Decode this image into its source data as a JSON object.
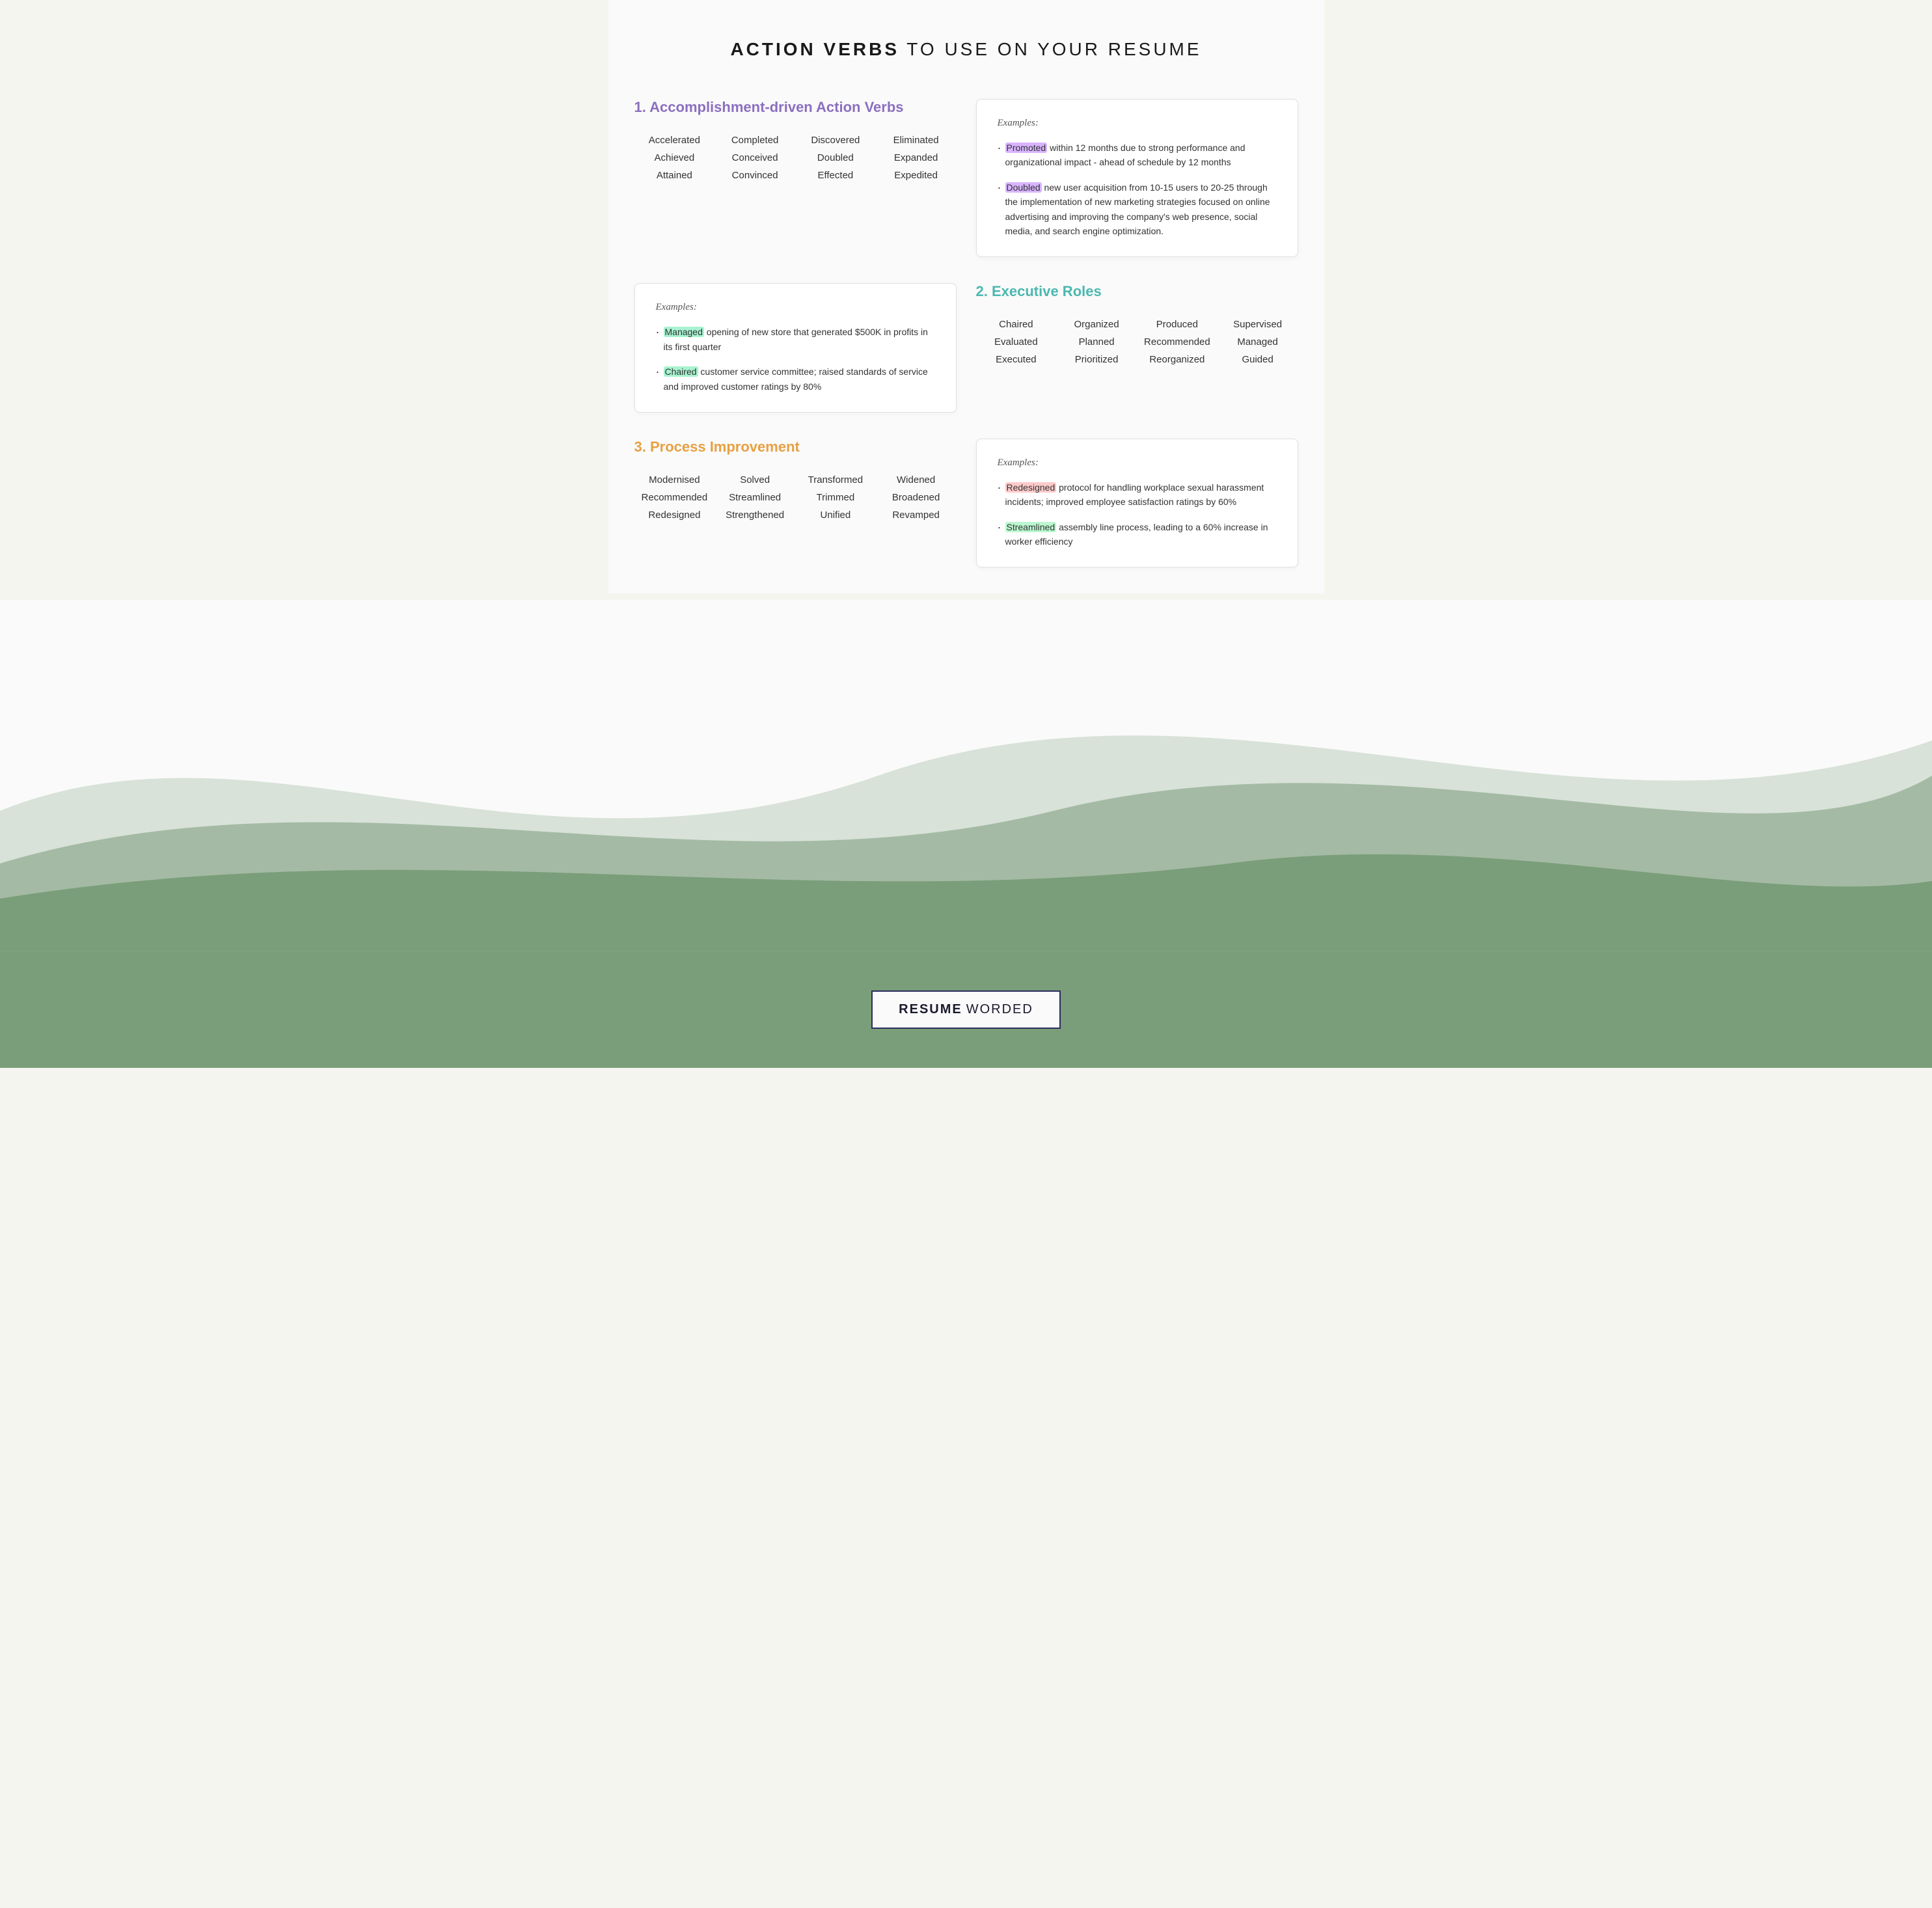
{
  "header": {
    "title_bold": "ACTION VERBS",
    "title_light": " TO USE ON YOUR RESUME"
  },
  "section1": {
    "title": "1. Accomplishment-driven Action Verbs",
    "words_col1": [
      "Accelerated",
      "Achieved",
      "Attained"
    ],
    "words_col2": [
      "Completed",
      "Conceived",
      "Convinced"
    ],
    "words_col3": [
      "Discovered",
      "Doubled",
      "Effected"
    ],
    "words_col4": [
      "Eliminated",
      "Expanded",
      "Expedited"
    ],
    "example_label": "Examples:",
    "examples": [
      {
        "highlight": "Promoted",
        "highlight_class": "highlight-purple",
        "text": " within 12 months due to strong performance and organizational impact - ahead of schedule by 12 months"
      },
      {
        "highlight": "Doubled",
        "highlight_class": "highlight-purple",
        "text": " new user acquisition from 10-15 users to 20-25 through the implementation of new marketing strategies focused on online advertising and improving the company's web presence, social media, and search engine optimization."
      }
    ]
  },
  "section1_example_left": {
    "example_label": "Examples:",
    "examples": [
      {
        "highlight": "Managed",
        "highlight_class": "highlight-teal",
        "text": " opening of new store that generated $500K in profits in its first quarter"
      },
      {
        "highlight": "Chaired",
        "highlight_class": "highlight-teal",
        "text": " customer service committee; raised standards of service and improved customer ratings by 80%"
      }
    ]
  },
  "section2": {
    "title": "2. Executive Roles",
    "words_col1": [
      "Chaired",
      "Evaluated",
      "Executed"
    ],
    "words_col2": [
      "Organized",
      "Planned",
      "Prioritized"
    ],
    "words_col3": [
      "Produced",
      "Recommended",
      "Reorganized"
    ],
    "words_col4": [
      "Supervised",
      "Managed",
      "Guided"
    ]
  },
  "section3": {
    "title": "3. Process Improvement",
    "words_col1": [
      "Modernised",
      "Recommended",
      "Redesigned"
    ],
    "words_col2": [
      "Solved",
      "Streamlined",
      "Strengthened"
    ],
    "words_col3": [
      "Transformed",
      "Trimmed",
      "Unified"
    ],
    "words_col4": [
      "Widened",
      "Broadened",
      "Revamped"
    ],
    "example_label": "Examples:",
    "examples": [
      {
        "highlight": "Redesigned",
        "highlight_class": "highlight-pink",
        "text": " protocol for handling workplace sexual harassment incidents; improved employee satisfaction ratings by 60%"
      },
      {
        "highlight": "Streamlined",
        "highlight_class": "highlight-green",
        "text": " assembly line process, leading to a 60% increase in worker efficiency"
      }
    ]
  },
  "logo": {
    "resume": "RESUME",
    "worded": " WORDED"
  }
}
